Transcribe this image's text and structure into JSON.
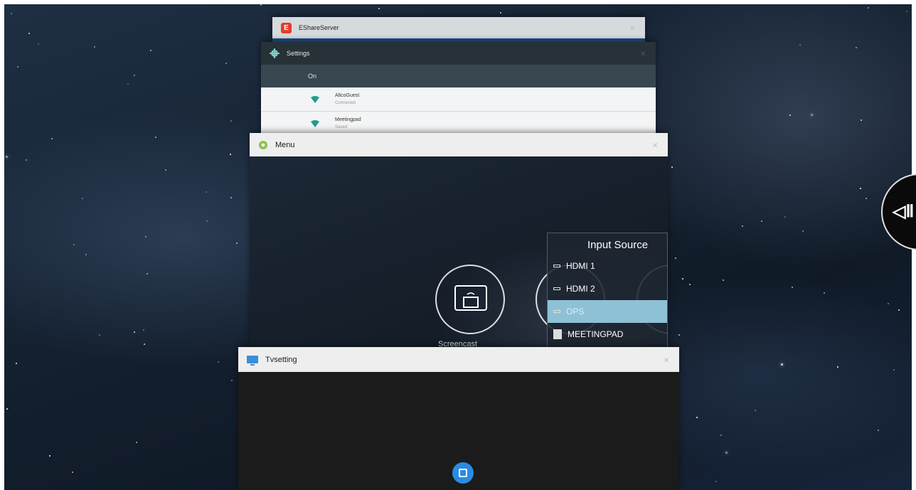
{
  "cards": {
    "eshare": {
      "title": "EShareServer",
      "logo": "E"
    },
    "settings": {
      "title": "Settings",
      "toggle_state": "On",
      "networks": [
        {
          "name": "AltcoGuest",
          "status": "Connected"
        },
        {
          "name": "Meetingpad",
          "status": "Saved"
        }
      ]
    },
    "menu": {
      "title": "Menu",
      "screencast_label": "Screencast",
      "input_source": {
        "title": "Input Source",
        "sources": [
          "HDMI 1",
          "HDMI 2",
          "OPS",
          "MEETINGPAD"
        ],
        "selected": "OPS"
      }
    },
    "tvsetting": {
      "title": "Tvsetting"
    }
  },
  "close_glyph": "×",
  "side_handle_glyph": "◁Ⅱ",
  "icons": {
    "eshare": "eshare-app-icon",
    "settings": "gear-icon",
    "menu": "menu-app-icon",
    "tvsetting": "tv-icon",
    "wifi": "wifi-icon",
    "screencast": "screencast-icon",
    "recents": "recents-icon"
  },
  "colors": {
    "accent": "#2a8be3",
    "selected_source": "#8fc1d6",
    "settings_header": "#263238"
  }
}
